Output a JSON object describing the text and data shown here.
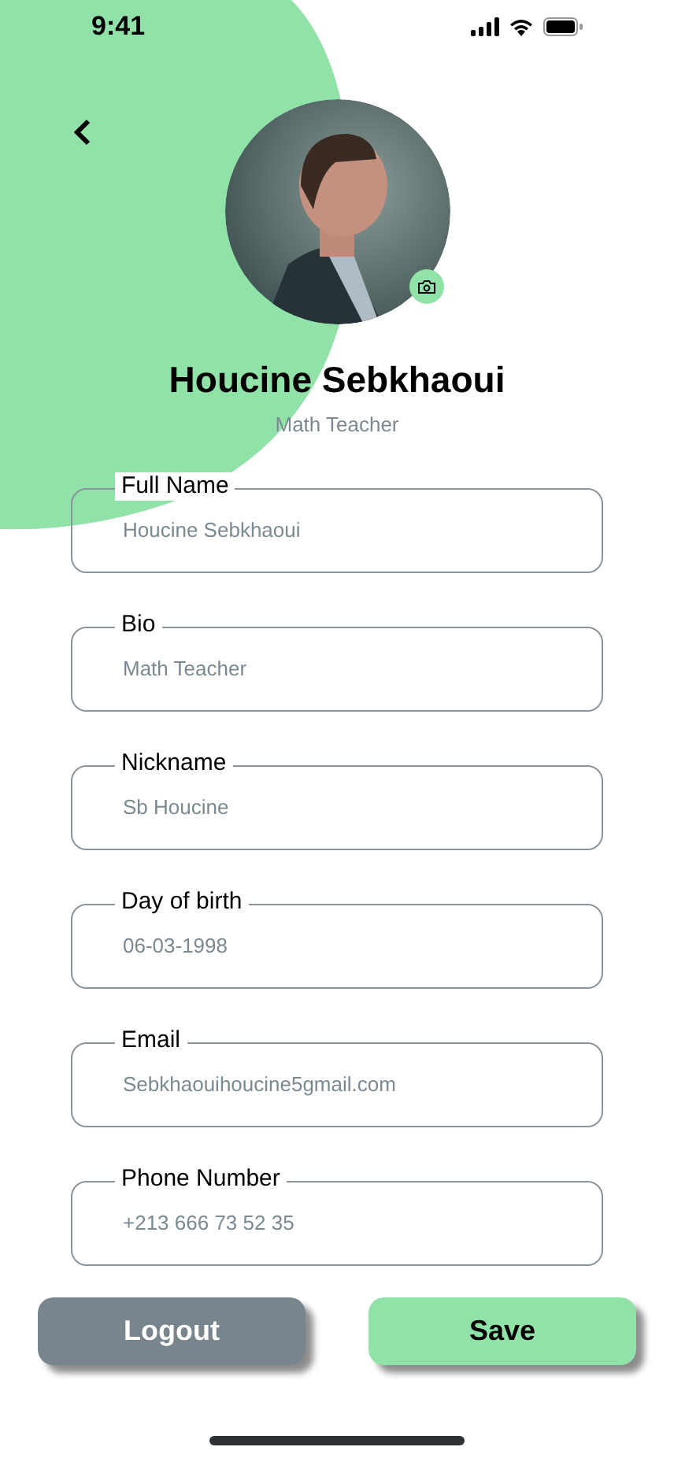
{
  "status_bar": {
    "time": "9:41"
  },
  "profile": {
    "name": "Houcine Sebkhaoui",
    "role": "Math Teacher"
  },
  "fields": [
    {
      "label": "Full Name",
      "value": "Houcine Sebkhaoui"
    },
    {
      "label": "Bio",
      "value": "Math Teacher"
    },
    {
      "label": "Nickname",
      "value": "Sb Houcine"
    },
    {
      "label": "Day of birth",
      "value": "06-03-1998"
    },
    {
      "label": "Email",
      "value": "Sebkhaouihoucine5gmail.com"
    },
    {
      "label": "Phone Number",
      "value": "+213 666 73 52 35"
    }
  ],
  "buttons": [
    {
      "label": "Logout",
      "kind": "secondary"
    },
    {
      "label": "Save",
      "kind": "primary"
    }
  ]
}
